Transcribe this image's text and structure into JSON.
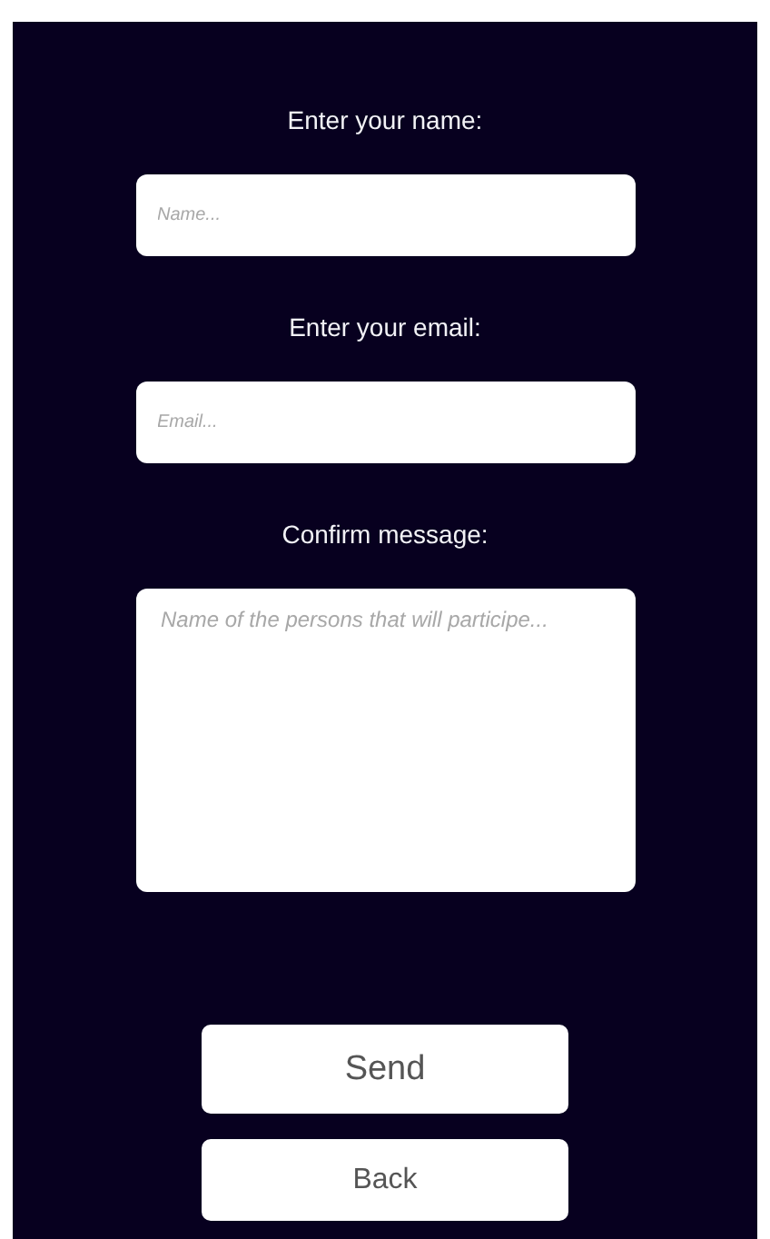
{
  "fields": [
    {
      "kind": "input",
      "label": "Enter your name:",
      "placeholder": "Name..."
    },
    {
      "kind": "input",
      "label": "Enter your email:",
      "placeholder": "Email..."
    },
    {
      "kind": "textarea",
      "label": "Confirm message:",
      "placeholder": "Name of the persons that will participe..."
    }
  ],
  "buttons": [
    {
      "label": "Send",
      "kind": "large"
    },
    {
      "label": "Back",
      "kind": "small"
    }
  ]
}
